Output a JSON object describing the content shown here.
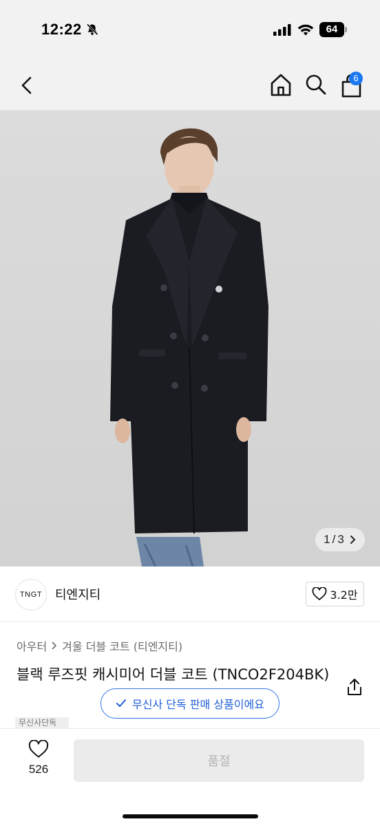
{
  "status_bar": {
    "time": "12:22",
    "battery_level": "64"
  },
  "nav": {
    "cart_badge_count": "6"
  },
  "product_image": {
    "current_index": "1",
    "total": "3",
    "separator": "/"
  },
  "brand": {
    "logo_text": "TNGT",
    "name": "티엔지티",
    "likes": "3.2만"
  },
  "breadcrumb": {
    "category": "아우터",
    "subcategory": "겨울 더블 코트 (티엔지티)"
  },
  "product": {
    "title": "블랙 루즈핏 캐시미어 더블 코트 (TNCO2F204BK)"
  },
  "badges": {
    "exclusive_label": "무신사 단독 판매 상품이에요",
    "partial_tag": "무신사단독"
  },
  "bottom_bar": {
    "wish_count": "526",
    "purchase_label": "품절"
  },
  "colors": {
    "accent_blue": "#1a78f2",
    "pill_blue": "#2f74e5",
    "header_bg": "#f2f2f2",
    "disabled_bg": "#ebebeb"
  },
  "icons": {
    "back": "chevron-left-icon",
    "home": "home-icon",
    "search": "search-icon",
    "cart": "shopping-bag-icon",
    "like": "heart-icon",
    "share": "share-icon",
    "check": "check-icon"
  }
}
